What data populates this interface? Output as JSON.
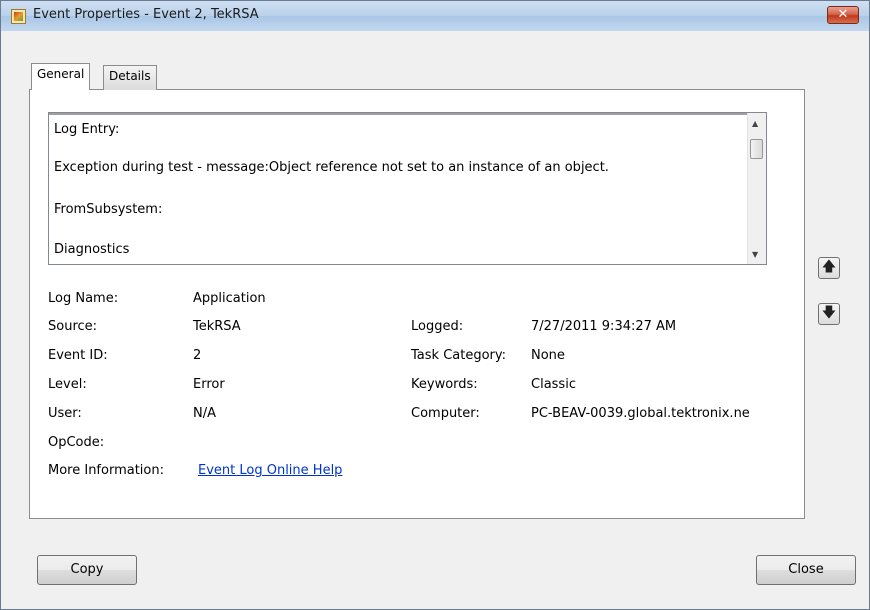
{
  "window": {
    "title": "Event Properties - Event 2, TekRSA",
    "close_glyph": "✕",
    "icon": "event-viewer-icon"
  },
  "tabs": [
    {
      "label": "General",
      "active": true
    },
    {
      "label": "Details",
      "active": false
    }
  ],
  "log_entry": {
    "lines": [
      "Log Entry:",
      "Exception during test - message:Object reference not set to an instance of an object.",
      "FromSubsystem:",
      "Diagnostics"
    ]
  },
  "fields": {
    "log_name": {
      "label": "Log Name:",
      "value": "Application"
    },
    "source": {
      "label": "Source:",
      "value": "TekRSA"
    },
    "event_id": {
      "label": "Event ID:",
      "value": "2"
    },
    "level": {
      "label": "Level:",
      "value": "Error"
    },
    "user": {
      "label": "User:",
      "value": "N/A"
    },
    "opcode": {
      "label": "OpCode:",
      "value": ""
    },
    "more_info": {
      "label": "More Information:",
      "value": "Event Log Online Help"
    },
    "logged": {
      "label": "Logged:",
      "value": "7/27/2011 9:34:27 AM"
    },
    "task_category": {
      "label": "Task Category:",
      "value": "None"
    },
    "keywords": {
      "label": "Keywords:",
      "value": "Classic"
    },
    "computer": {
      "label": "Computer:",
      "value": "PC-BEAV-0039.global.tektronix.ne"
    }
  },
  "nav": {
    "up_glyph": "🡅",
    "down_glyph": "🡇"
  },
  "buttons": {
    "copy": "Copy",
    "close": "Close"
  }
}
